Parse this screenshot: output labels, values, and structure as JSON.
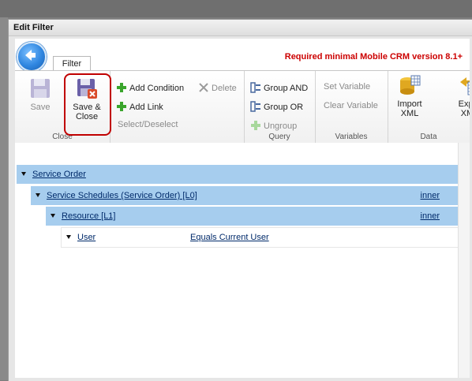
{
  "dialog": {
    "title": "Edit Filter"
  },
  "tab": {
    "label": "Filter"
  },
  "notice": "Required minimal Mobile CRM version 8.1+",
  "groups": {
    "close": {
      "label": "Close",
      "save": "Save",
      "save_close_line1": "Save &",
      "save_close_line2": "Close"
    },
    "select": {
      "add_condition": "Add Condition",
      "delete": "Delete",
      "add_link": "Add Link",
      "select_deselect": "Select/Deselect"
    },
    "query": {
      "label": "Query",
      "group_and": "Group AND",
      "group_or": "Group OR",
      "ungroup": "Ungroup"
    },
    "variables": {
      "label": "Variables",
      "set_variable": "Set Variable",
      "clear_variable": "Clear Variable"
    },
    "data": {
      "label": "Data",
      "import_line1": "Import",
      "import_line2": "XML",
      "export_line1": "Expor",
      "export_line2": "XML"
    }
  },
  "tree": {
    "rows": [
      {
        "label": "Service Order"
      },
      {
        "label": "Service Schedules (Service Order) [L0]",
        "join": "inner"
      },
      {
        "label": "Resource [L1]",
        "join": "inner"
      },
      {
        "label": "User",
        "condition": "Equals Current User"
      }
    ]
  },
  "colors": {
    "accent_red": "#cc0000",
    "row_highlight": "#a6cdee",
    "link": "#002a6a"
  }
}
